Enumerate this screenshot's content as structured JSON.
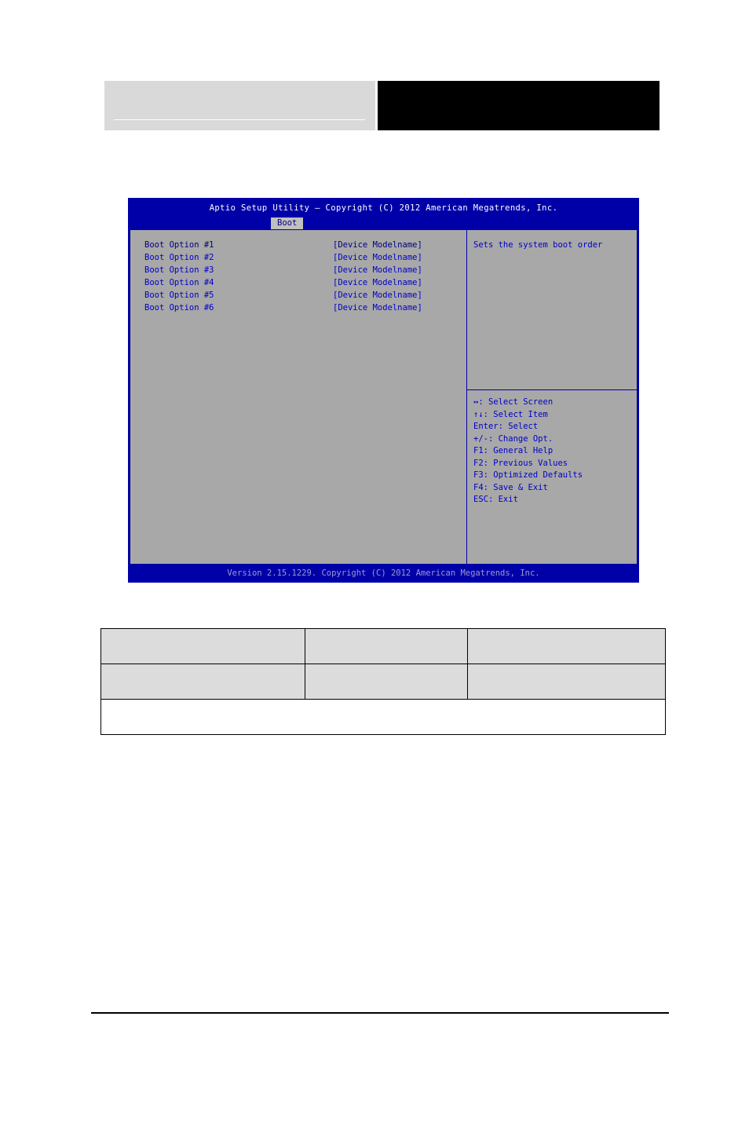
{
  "bios": {
    "title": "Aptio Setup Utility – Copyright (C) 2012 American Megatrends, Inc.",
    "tab": "Boot",
    "boot_options": [
      {
        "label": "Boot Option #1",
        "value": "[Device Modelname]"
      },
      {
        "label": "Boot Option #2",
        "value": "[Device Modelname]"
      },
      {
        "label": "Boot Option #3",
        "value": "[Device Modelname]"
      },
      {
        "label": "Boot Option #4",
        "value": "[Device Modelname]"
      },
      {
        "label": "Boot Option #5",
        "value": "[Device Modelname]"
      },
      {
        "label": "Boot Option #6",
        "value": "[Device Modelname]"
      }
    ],
    "help": "Sets the system boot order",
    "keys": [
      "↔: Select Screen",
      "↑↓: Select Item",
      "Enter: Select",
      "+/-: Change Opt.",
      "F1: General Help",
      "F2: Previous Values",
      "F3: Optimized Defaults",
      "F4: Save & Exit",
      "ESC: Exit"
    ],
    "footer": "Version 2.15.1229. Copyright (C) 2012 American Megatrends, Inc."
  },
  "table": {
    "rows": [
      {
        "c1": "",
        "c2": "",
        "c3": ""
      },
      {
        "c1": "",
        "c2": "",
        "c3": ""
      }
    ],
    "note": ""
  }
}
